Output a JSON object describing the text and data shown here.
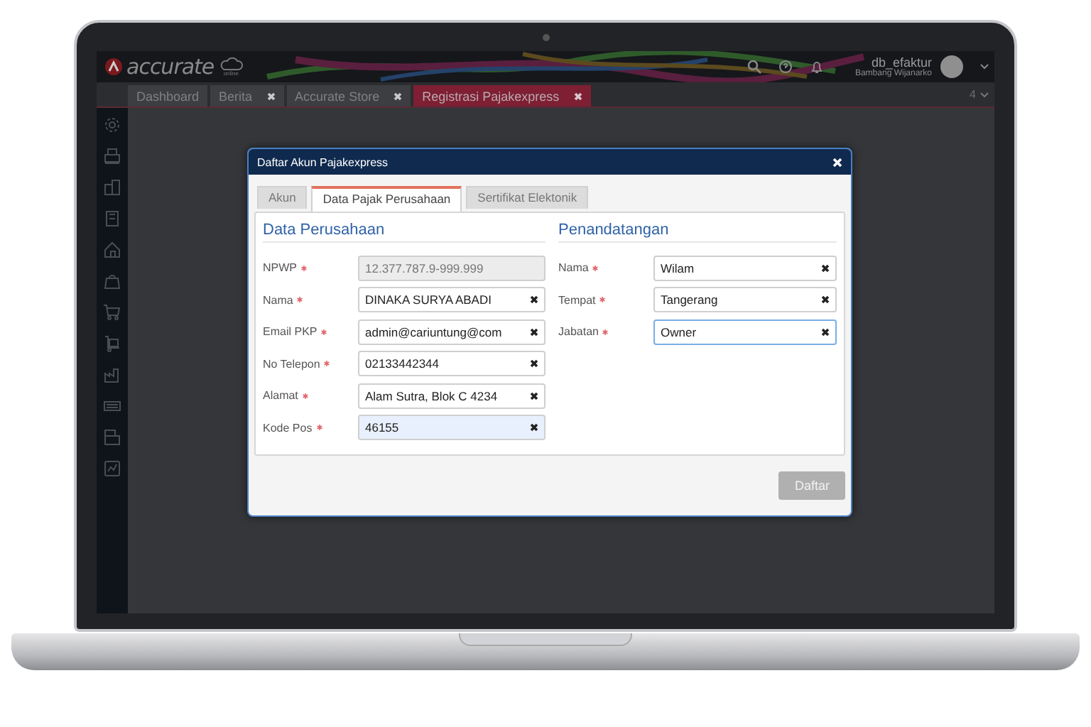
{
  "app": {
    "logo": "accurate",
    "logo_sub": "online",
    "user": {
      "database": "db_efaktur",
      "name": "Bambang Wijanarko"
    },
    "tabs": [
      {
        "label": "Dashboard",
        "closable": false,
        "selected": false
      },
      {
        "label": "Berita",
        "closable": true,
        "selected": false
      },
      {
        "label": "Accurate Store",
        "closable": true,
        "selected": false
      },
      {
        "label": "Registrasi Pajakexpress",
        "closable": true,
        "selected": true
      }
    ],
    "tab_count": "4"
  },
  "dialog": {
    "title": "Daftar Akun Pajakexpress",
    "tabs": [
      {
        "label": "Akun",
        "selected": false
      },
      {
        "label": "Data Pajak Perusahaan",
        "selected": true
      },
      {
        "label": "Sertifikat Elektonik",
        "selected": false
      }
    ],
    "sections": [
      {
        "heading": "Data Perusahaan",
        "fields": [
          {
            "label": "NPWP",
            "required": true,
            "value": "12.377.787.9-999.999",
            "disabled": true,
            "highlighted": false,
            "focused": false,
            "clearable": false
          },
          {
            "label": "Nama",
            "required": true,
            "value": "DINAKA SURYA ABADI",
            "disabled": false,
            "highlighted": false,
            "focused": false,
            "clearable": true
          },
          {
            "label": "Email PKP",
            "required": true,
            "value": "admin@cariuntung@com",
            "disabled": false,
            "highlighted": false,
            "focused": false,
            "clearable": true
          },
          {
            "label": "No Telepon",
            "required": true,
            "value": "02133442344",
            "disabled": false,
            "highlighted": false,
            "focused": false,
            "clearable": true
          },
          {
            "label": "Alamat",
            "required": true,
            "value": "Alam Sutra, Blok C 4234",
            "disabled": false,
            "highlighted": false,
            "focused": false,
            "clearable": true
          },
          {
            "label": "Kode Pos",
            "required": true,
            "value": "46155",
            "disabled": false,
            "highlighted": true,
            "focused": false,
            "clearable": true
          }
        ]
      },
      {
        "heading": "Penandatangan",
        "fields": [
          {
            "label": "Nama",
            "required": true,
            "value": "Wilam",
            "disabled": false,
            "highlighted": false,
            "focused": false,
            "clearable": true
          },
          {
            "label": "Tempat",
            "required": true,
            "value": "Tangerang",
            "disabled": false,
            "highlighted": false,
            "focused": false,
            "clearable": true
          },
          {
            "label": "Jabatan",
            "required": true,
            "value": "Owner",
            "disabled": false,
            "highlighted": false,
            "focused": true,
            "clearable": true
          }
        ]
      }
    ],
    "submit": {
      "label": "Daftar",
      "disabled": true
    }
  }
}
